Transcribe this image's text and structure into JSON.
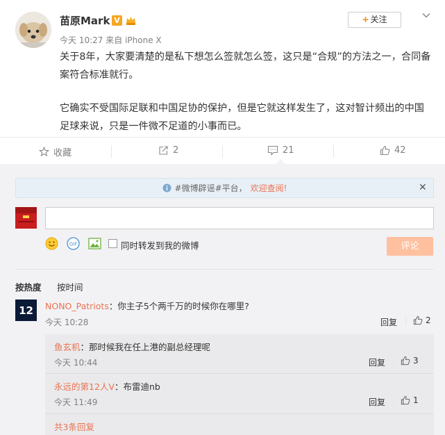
{
  "post": {
    "username": "苗原Mark",
    "verified_badge": "V",
    "time": "今天 10:27",
    "source_prefix": "来自",
    "source": "iPhone X",
    "follow_label": "关注",
    "paragraph1": "关于8年，大家要清楚的是私下想怎么签就怎么签，这只是“合规”的方法之一，合同备案符合标准就行。",
    "paragraph2": "它确实不受国际足联和中国足协的保护，但是它就这样发生了，这对智计频出的中国足球来说，只是一件微不足道的小事而已。"
  },
  "actions": {
    "favorite_label": "收藏",
    "repost_count": "2",
    "comment_count": "21",
    "like_count": "42"
  },
  "notice": {
    "text": "#微博辟谣#平台，",
    "link": "欢迎查阅!"
  },
  "composer": {
    "repost_check_label": "同时转发到我的微博",
    "submit_label": "评论"
  },
  "sort": {
    "hot_label": "按热度",
    "time_label": "按时间"
  },
  "comments": [
    {
      "avatar_text": "12",
      "name": "NONO_Patriots",
      "text": "：你主子5个两千万的时候你在哪里?",
      "time": "今天 10:28",
      "reply_label": "回复",
      "likes": "2"
    }
  ],
  "replies": [
    {
      "name": "鱼玄机",
      "text": "：那时候我在任上港的副总经理呢",
      "time": "今天 10:44",
      "reply_label": "回复",
      "likes": "3"
    },
    {
      "name": "永远的第12人V",
      "text": "：布雷迪nb",
      "time": "今天 11:49",
      "reply_label": "回复",
      "likes": "1"
    }
  ],
  "more_replies_label": "共3条回复",
  "colors": {
    "accent": "#eb7350",
    "follow_plus": "#ff8200",
    "submit_disabled": "#ffc09f",
    "badge": "#f5a623"
  }
}
